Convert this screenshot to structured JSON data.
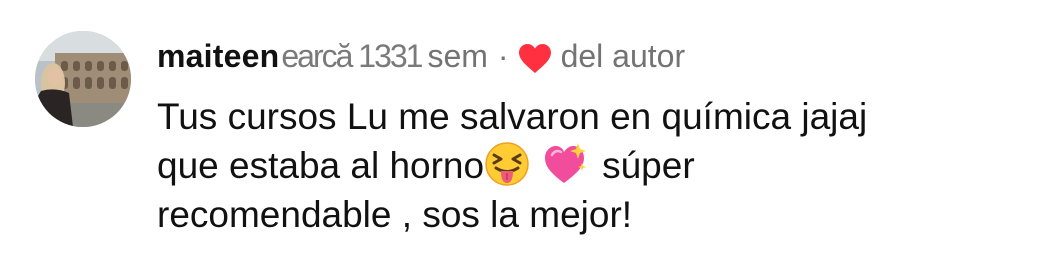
{
  "comment": {
    "username": "maiteen",
    "overlap_text": "earcă 1331",
    "time": "sem",
    "separator": "·",
    "liked_label": "del autor",
    "text_lines": [
      "Tus cursos Lu me salvaron en química jajaj",
      "que estaba al horno",
      "súper",
      "recomendable , sos la mejor!"
    ],
    "emojis": [
      "squinting-face-with-tongue-emoji",
      "sparkling-heart-emoji"
    ],
    "heart_color": "#ff3040"
  }
}
